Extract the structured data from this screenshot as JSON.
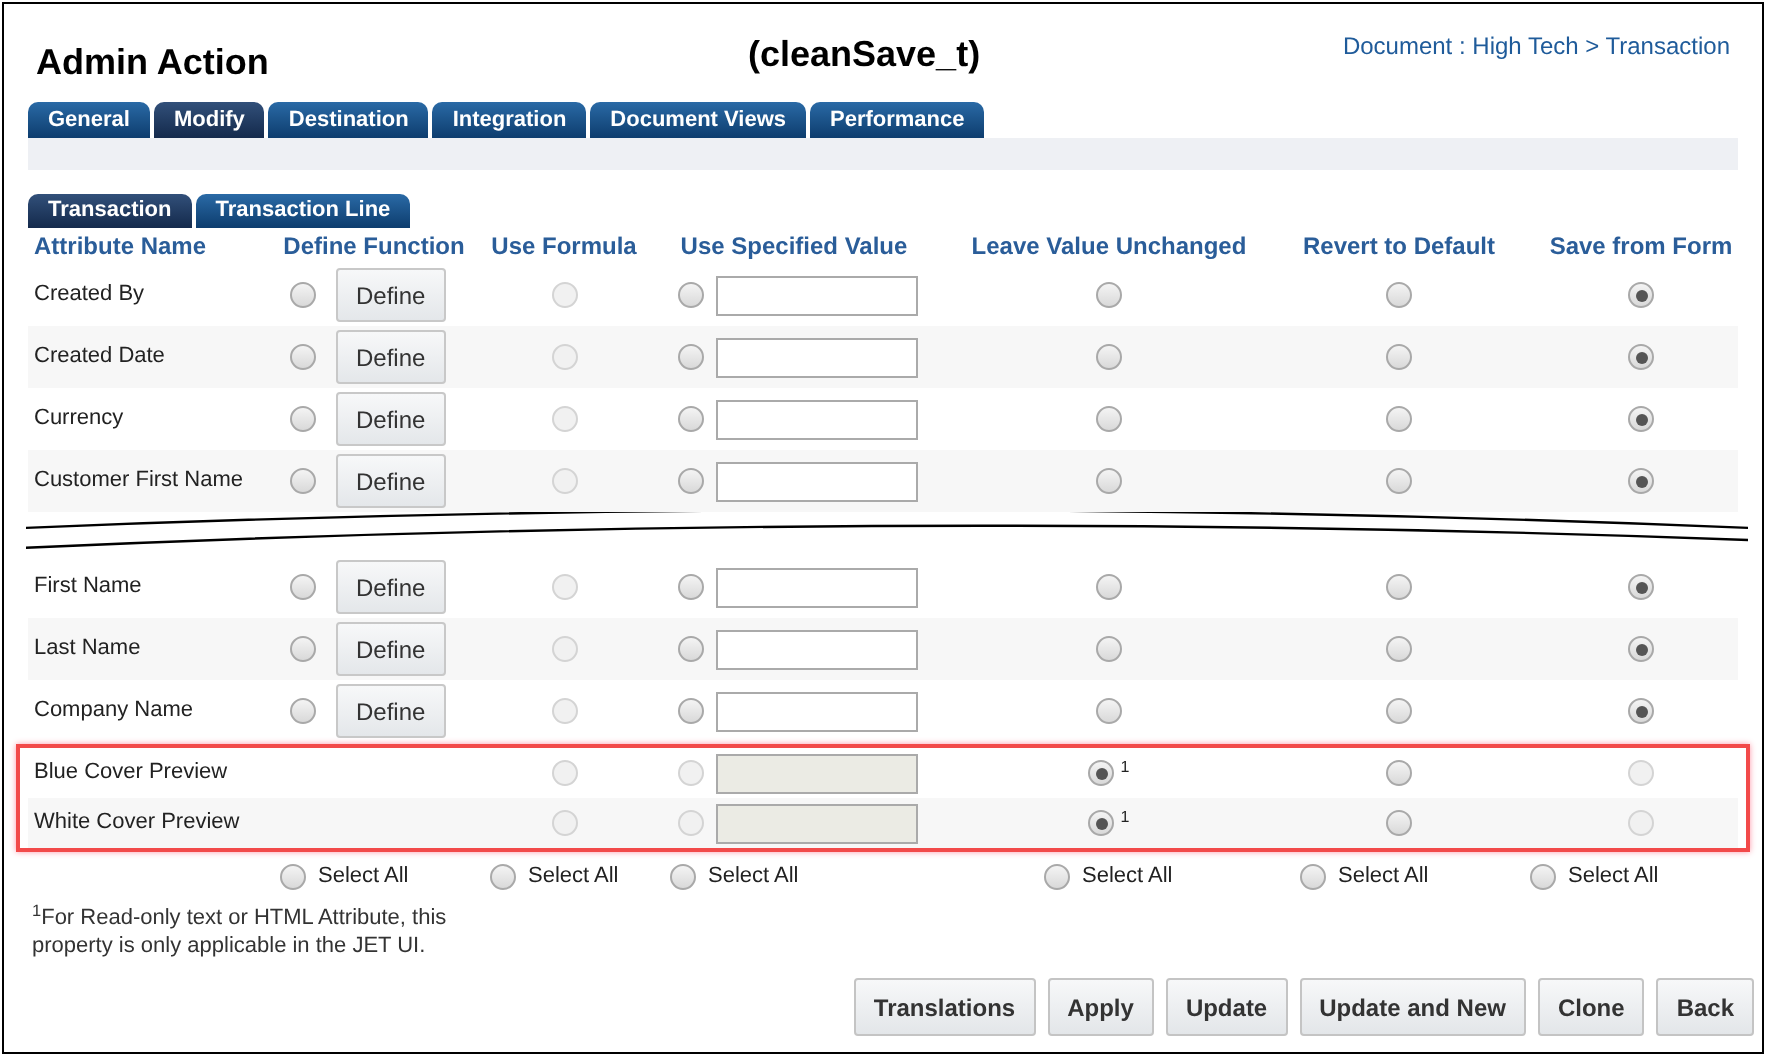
{
  "title": "Admin Action",
  "subtitle": "(cleanSave_t)",
  "breadcrumb": "Document : High Tech > Transaction",
  "tabs": [
    {
      "label": "General",
      "selected": false
    },
    {
      "label": "Modify",
      "selected": true
    },
    {
      "label": "Destination",
      "selected": false
    },
    {
      "label": "Integration",
      "selected": false
    },
    {
      "label": "Document Views",
      "selected": false
    },
    {
      "label": "Performance",
      "selected": false
    }
  ],
  "subtabs": [
    {
      "label": "Transaction",
      "selected": true
    },
    {
      "label": "Transaction Line",
      "selected": false
    }
  ],
  "columns": [
    "Attribute Name",
    "Define Function",
    "Use Formula",
    "Use Specified Value",
    "Leave Value Unchanged",
    "Revert to Default",
    "Save from Form"
  ],
  "rows_top": [
    {
      "kind": "editable",
      "name": "Created By",
      "button": "Define",
      "options": [
        {
          "selected": false,
          "disabled": false
        },
        {
          "selected": false,
          "disabled": true
        },
        {
          "selected": false,
          "disabled": false
        },
        {
          "selected": false,
          "disabled": false
        },
        {
          "selected": false,
          "disabled": false
        },
        {
          "selected": true,
          "disabled": false
        }
      ]
    },
    {
      "kind": "editable",
      "name": "Created Date",
      "button": "Define",
      "options": [
        {
          "selected": false,
          "disabled": false
        },
        {
          "selected": false,
          "disabled": true
        },
        {
          "selected": false,
          "disabled": false
        },
        {
          "selected": false,
          "disabled": false
        },
        {
          "selected": false,
          "disabled": false
        },
        {
          "selected": true,
          "disabled": false
        }
      ]
    },
    {
      "kind": "editable",
      "name": "Currency",
      "button": "Define",
      "options": [
        {
          "selected": false,
          "disabled": false
        },
        {
          "selected": false,
          "disabled": true
        },
        {
          "selected": false,
          "disabled": false
        },
        {
          "selected": false,
          "disabled": false
        },
        {
          "selected": false,
          "disabled": false
        },
        {
          "selected": true,
          "disabled": false
        }
      ]
    },
    {
      "kind": "editable",
      "name": "Customer First Name",
      "button": "Define",
      "options": [
        {
          "selected": false,
          "disabled": false
        },
        {
          "selected": false,
          "disabled": true
        },
        {
          "selected": false,
          "disabled": false
        },
        {
          "selected": false,
          "disabled": false
        },
        {
          "selected": false,
          "disabled": false
        },
        {
          "selected": true,
          "disabled": false
        }
      ]
    }
  ],
  "rows_bottom": [
    {
      "kind": "editable",
      "name": "First Name",
      "button": "Define",
      "options": [
        {
          "selected": false,
          "disabled": false
        },
        {
          "selected": false,
          "disabled": true
        },
        {
          "selected": false,
          "disabled": false
        },
        {
          "selected": false,
          "disabled": false
        },
        {
          "selected": false,
          "disabled": false
        },
        {
          "selected": true,
          "disabled": false
        }
      ]
    },
    {
      "kind": "editable",
      "name": "Last Name",
      "button": "Define",
      "options": [
        {
          "selected": false,
          "disabled": false
        },
        {
          "selected": false,
          "disabled": true
        },
        {
          "selected": false,
          "disabled": false
        },
        {
          "selected": false,
          "disabled": false
        },
        {
          "selected": false,
          "disabled": false
        },
        {
          "selected": true,
          "disabled": false
        }
      ]
    },
    {
      "kind": "editable",
      "name": "Company Name",
      "button": "Define",
      "options": [
        {
          "selected": false,
          "disabled": false
        },
        {
          "selected": false,
          "disabled": true
        },
        {
          "selected": false,
          "disabled": false
        },
        {
          "selected": false,
          "disabled": false
        },
        {
          "selected": false,
          "disabled": false
        },
        {
          "selected": true,
          "disabled": false
        }
      ]
    }
  ],
  "rows_highlighted": [
    {
      "kind": "readonly",
      "name": "Blue Cover Preview",
      "note": "1",
      "options": [
        {
          "selected": false,
          "disabled": true
        },
        {
          "selected": false,
          "disabled": true
        },
        {
          "selected": true,
          "disabled": false
        },
        {
          "selected": false,
          "disabled": false
        },
        {
          "selected": false,
          "disabled": true
        }
      ]
    },
    {
      "kind": "readonly",
      "name": "White Cover Preview",
      "note": "1",
      "options": [
        {
          "selected": false,
          "disabled": true
        },
        {
          "selected": false,
          "disabled": true
        },
        {
          "selected": true,
          "disabled": false
        },
        {
          "selected": false,
          "disabled": false
        },
        {
          "selected": false,
          "disabled": true
        }
      ]
    }
  ],
  "select_all": [
    {
      "label": "Select All",
      "selected": false
    },
    {
      "label": "Select All",
      "selected": false
    },
    {
      "label": "Select All",
      "selected": false
    },
    {
      "label": "Select All",
      "selected": false
    },
    {
      "label": "Select All",
      "selected": false
    },
    {
      "label": "Select All",
      "selected": false
    }
  ],
  "footnote": "$^{1}$For Read-only text or HTML Attribute, this property is only applicable in the JET UI.",
  "buttons": [
    "Translations",
    "Apply",
    "Update",
    "Update and New",
    "Clone",
    "Back"
  ]
}
